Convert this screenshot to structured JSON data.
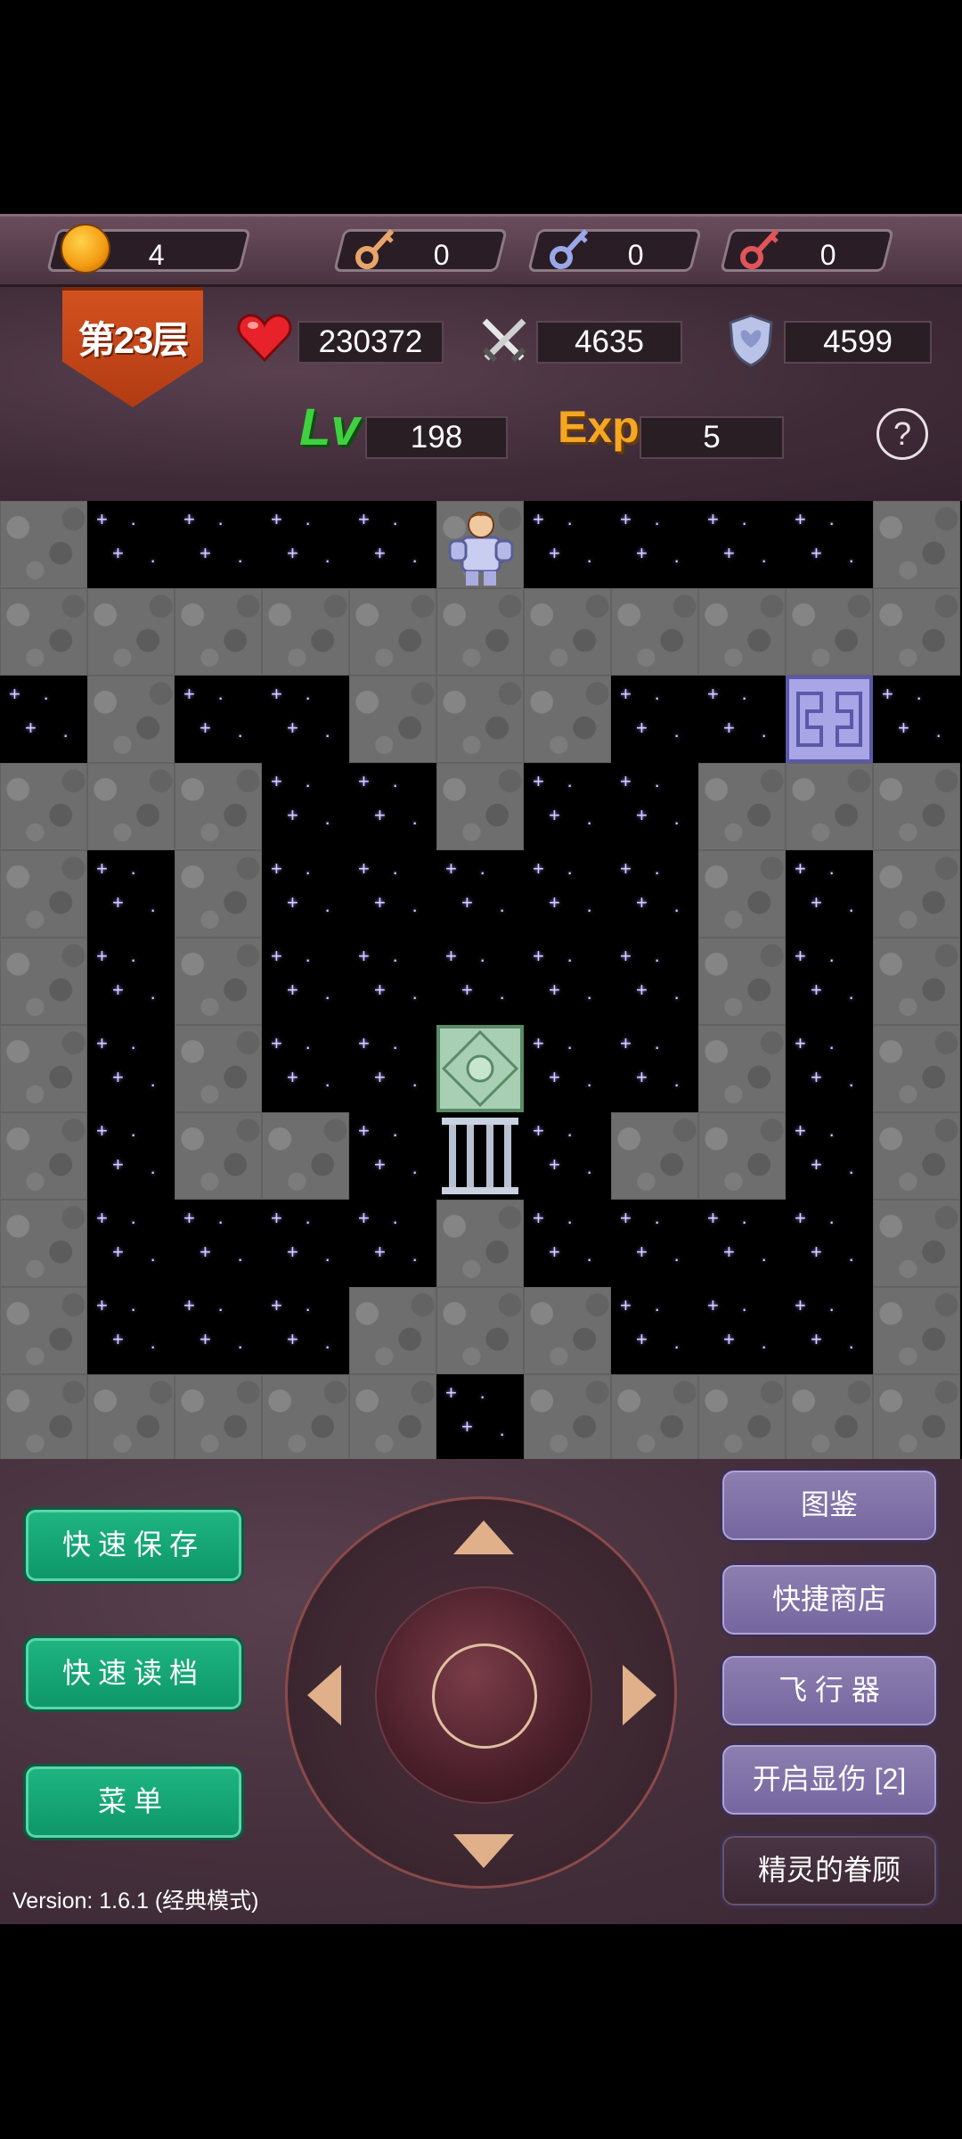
{
  "resources": {
    "gold": "4",
    "yellow_keys": "0",
    "blue_keys": "0",
    "red_keys": "0"
  },
  "floor": {
    "label": "第23层"
  },
  "stats": {
    "hp": "230372",
    "attack": "4635",
    "defense": "4599",
    "level_label": "Lv",
    "level": "198",
    "exp_label": "Exp",
    "exp": "5",
    "help_symbol": "?"
  },
  "buttons": {
    "quick_save": "快速保存",
    "quick_load": "快速读档",
    "menu": "菜单",
    "encyclopedia": "图鉴",
    "quick_shop": "快捷商店",
    "fly": "飞 行 器",
    "show_damage": "开启显伤 [2]",
    "fairy": "精灵的眷顾"
  },
  "version": "Version: 1.6.1 (经典模式)",
  "colors": {
    "gold": "#f5a623",
    "yellow_key": "#e8a56a",
    "blue_key": "#9aa8e8",
    "red_key": "#e0545a",
    "heart": "#e8222a",
    "green_button": "#16a574",
    "purple_button": "#8172a8"
  }
}
